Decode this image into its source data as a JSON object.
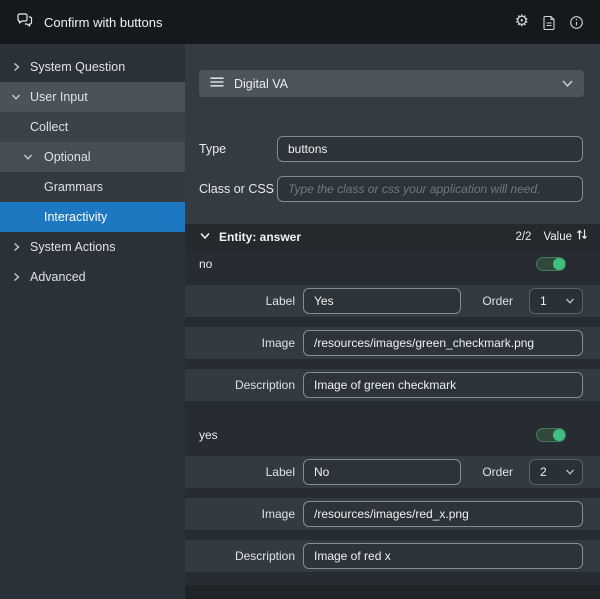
{
  "header": {
    "title": "Confirm with buttons"
  },
  "sidebar": {
    "items": [
      {
        "label": "System Question",
        "expanded": false
      },
      {
        "label": "User Input",
        "expanded": true
      },
      {
        "label": "Collect"
      },
      {
        "label": "Optional",
        "expanded": true
      },
      {
        "label": "Grammars"
      },
      {
        "label": "Interactivity",
        "selected": true
      },
      {
        "label": "System Actions",
        "expanded": false
      },
      {
        "label": "Advanced",
        "expanded": false
      }
    ]
  },
  "main": {
    "channel": {
      "value": "Digital VA"
    },
    "type_field": {
      "label": "Type",
      "value": "buttons"
    },
    "css_field": {
      "label": "Class or CSS",
      "placeholder": "Type the class or css your application will need."
    },
    "entity": {
      "title": "Entity: answer",
      "count": "2/2",
      "sort_label": "Value"
    },
    "labels": {
      "label": "Label",
      "order": "Order",
      "image": "Image",
      "description": "Description"
    },
    "entries": [
      {
        "name": "no",
        "enabled": true,
        "label_value": "Yes",
        "order": "1",
        "image": "/resources/images/green_checkmark.png",
        "description": "Image of green checkmark"
      },
      {
        "name": "yes",
        "enabled": true,
        "label_value": "No",
        "order": "2",
        "image": "/resources/images/red_x.png",
        "description": "Image of red x"
      }
    ]
  },
  "icons": {
    "app": "chat-bubbles",
    "settings": "gear",
    "notes": "document",
    "info": "info-circle",
    "channel": "layers",
    "sort": "sort-arrows"
  },
  "colors": {
    "selected_blue": "#1d78c1",
    "toggle_green": "#3fbf83",
    "topbar": "#15191c",
    "panel": "#343b42"
  }
}
